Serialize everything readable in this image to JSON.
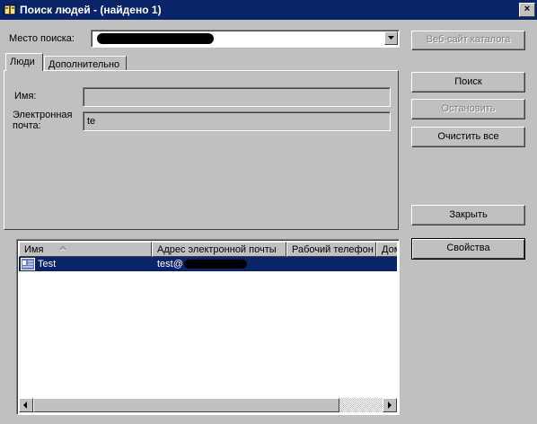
{
  "window": {
    "title": "Поиск людей - (найдено 1)",
    "close_label": "×"
  },
  "location": {
    "label": "Место поиска:"
  },
  "tabs": [
    {
      "label": "Люди"
    },
    {
      "label": "Дополнительно"
    }
  ],
  "form": {
    "name_label": "Имя:",
    "email_label_line1": "Электронная",
    "email_label_line2": "почта:",
    "name_value": "",
    "email_value": "te"
  },
  "buttons": {
    "directory_site": "Веб-сайт каталога",
    "search": "Поиск",
    "stop": "Остановить",
    "clear_all": "Очистить все",
    "close": "Закрыть",
    "properties": "Свойства"
  },
  "results": {
    "columns": [
      "Имя",
      "Адрес электронной почты",
      "Рабочий телефон",
      "Домашний"
    ],
    "rows": [
      {
        "name": "Test",
        "email": "test@"
      }
    ]
  },
  "colors": {
    "titlebar": "#0a246a",
    "window_bg": "#c0c0c0",
    "selection": "#0a246a"
  }
}
